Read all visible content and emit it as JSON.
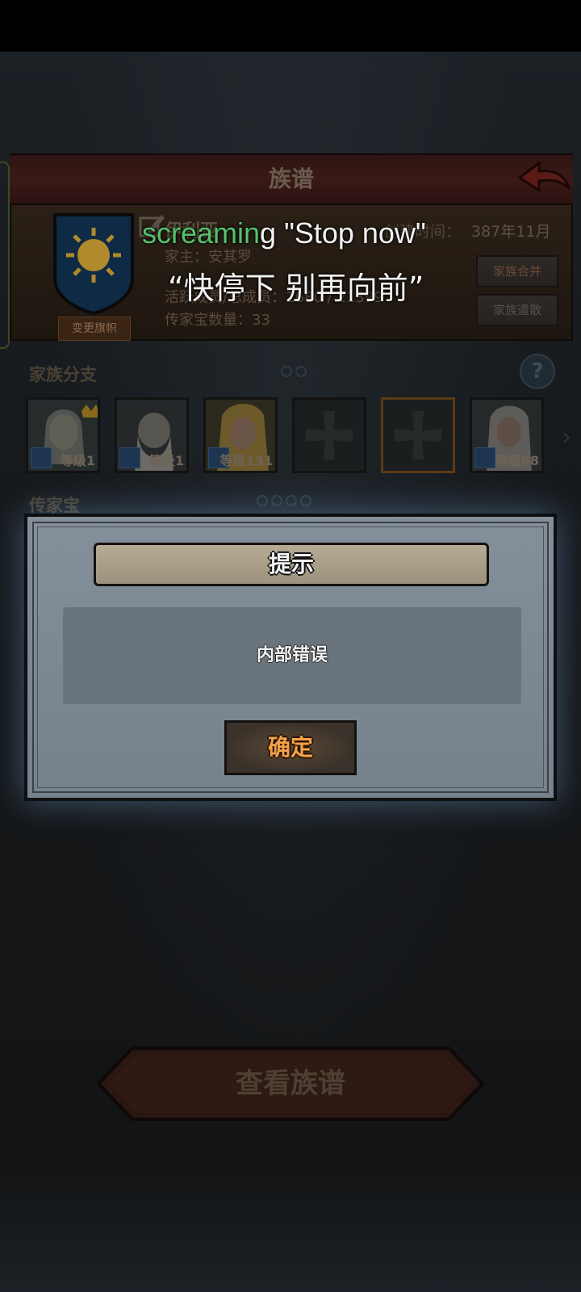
{
  "header": {
    "title": "族谱"
  },
  "clan": {
    "name": "伊利亚",
    "leader_line": "家主：安其罗",
    "members_line": "活跃成员/总成员：1680 / 21399",
    "heirloom_line": "传家宝数量：33",
    "created_label": "创建时间：",
    "created_value": "387年11月",
    "merge_button": "家族合并",
    "disband_button": "家族遣散",
    "change_banner_button": "变更旗帜"
  },
  "branches": {
    "title": "家族分支",
    "help": "?",
    "cards": [
      {
        "level": "等级1",
        "crown": true
      },
      {
        "level": "等级1",
        "crown": false
      },
      {
        "level": "等级131",
        "crown": false
      },
      {
        "level": "",
        "crown": false
      },
      {
        "level": "",
        "crown": false
      },
      {
        "level": "等级68",
        "crown": false
      }
    ]
  },
  "heirlooms": {
    "title": "传家宝"
  },
  "dialog": {
    "title": "提示",
    "message": "内部错误",
    "confirm": "确定"
  },
  "bottom": {
    "view_tree_button": "查看族谱"
  },
  "subtitle": {
    "line1_highlight": "screamin",
    "line1_rest": "g \"Stop now\"",
    "line2": "“快停下 别再向前”"
  },
  "colors": {
    "dialog_bg": "#7d8994",
    "confirm_text": "#f3a24a",
    "subtitle_highlight": "#55c26c"
  }
}
